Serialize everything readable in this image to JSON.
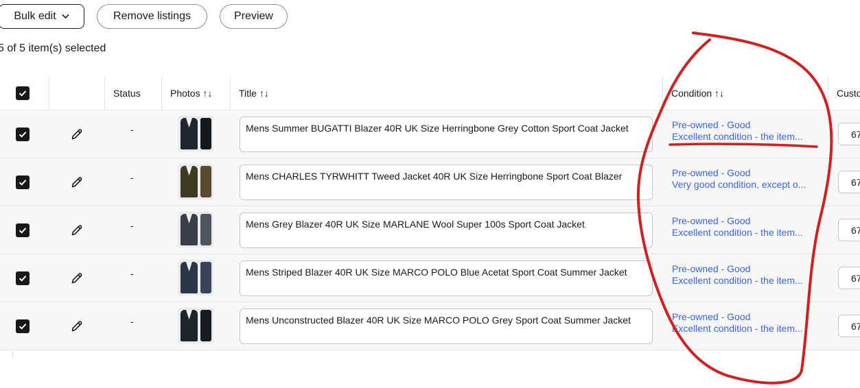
{
  "toolbar": {
    "bulk_edit_label": "Bulk edit",
    "remove_label": "Remove listings",
    "preview_label": "Preview"
  },
  "selection": {
    "text": "5 of 5 item(s) selected"
  },
  "table": {
    "columns": {
      "status": "Status",
      "photos": "Photos ↑↓",
      "title": "Title ↑↓",
      "condition": "Condition ↑↓",
      "custom": "Custo"
    },
    "rows": [
      {
        "status": "-",
        "title": "Mens Summer BUGATTI Blazer 40R UK Size Herringbone Grey Cotton Sport Coat Jacket",
        "condition": "Pre-owned - Good",
        "condition_desc": "Excellent condition - the item...",
        "custom": "67",
        "jacket_color": "#1f2630",
        "second_color": "#15181d"
      },
      {
        "status": "-",
        "title": "Mens CHARLES TYRWHITT Tweed Jacket 40R UK Size Herringbone Sport Coat Blazer",
        "condition": "Pre-owned - Good",
        "condition_desc": "Very good condition, except o...",
        "custom": "67",
        "jacket_color": "#3e3a22",
        "second_color": "#5a4a2e"
      },
      {
        "status": "-",
        "title": "Mens Grey Blazer 40R UK Size MARLANE Wool Super 100s Sport Coat Jacket",
        "condition": "Pre-owned - Good",
        "condition_desc": "Excellent condition - the item...",
        "custom": "67",
        "jacket_color": "#3a3d45",
        "second_color": "#50545c"
      },
      {
        "status": "-",
        "title": "Mens Striped Blazer 40R UK Size MARCO POLO Blue Acetat Sport Coat Summer Jacket",
        "condition": "Pre-owned - Good",
        "condition_desc": "Excellent condition - the item...",
        "custom": "67",
        "jacket_color": "#2c3448",
        "second_color": "#3a4358"
      },
      {
        "status": "-",
        "title": "Mens Unconstructed Blazer 40R UK Size MARCO POLO Grey Sport Coat Summer Jacket",
        "condition": "Pre-owned - Good",
        "condition_desc": "Excellent condition - the item...",
        "custom": "67",
        "jacket_color": "#20252c",
        "second_color": "#181b20"
      }
    ]
  },
  "colors": {
    "link": "#3665f3",
    "annotation": "#d0201f",
    "row_bg": "#f7f7f7"
  },
  "icons": [
    "chevron-down-icon",
    "checkmark-icon",
    "pencil-icon",
    "sort-icon"
  ]
}
